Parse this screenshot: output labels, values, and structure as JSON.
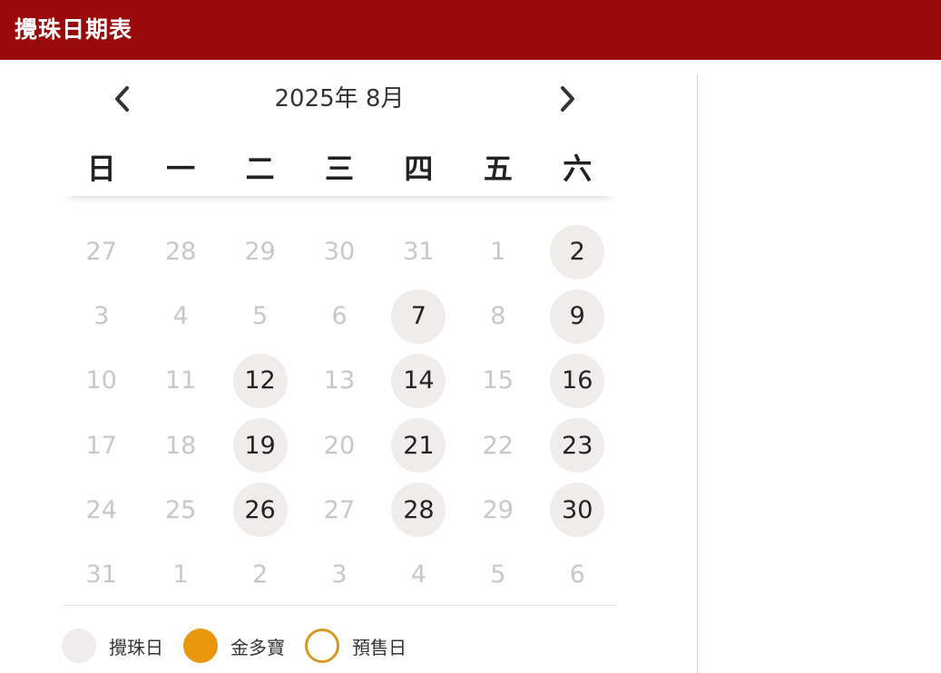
{
  "header": {
    "title": "攪珠日期表"
  },
  "calendar": {
    "month_label": "2025年 8月",
    "prev_icon": "chevron-left-icon",
    "next_icon": "chevron-right-icon",
    "weekdays": [
      "日",
      "一",
      "二",
      "三",
      "四",
      "五",
      "六"
    ],
    "weeks": [
      [
        {
          "d": "27",
          "a": false
        },
        {
          "d": "28",
          "a": false
        },
        {
          "d": "29",
          "a": false
        },
        {
          "d": "30",
          "a": false
        },
        {
          "d": "31",
          "a": false
        },
        {
          "d": "1",
          "a": false
        },
        {
          "d": "2",
          "a": true
        }
      ],
      [
        {
          "d": "3",
          "a": false
        },
        {
          "d": "4",
          "a": false
        },
        {
          "d": "5",
          "a": false
        },
        {
          "d": "6",
          "a": false
        },
        {
          "d": "7",
          "a": true
        },
        {
          "d": "8",
          "a": false
        },
        {
          "d": "9",
          "a": true
        }
      ],
      [
        {
          "d": "10",
          "a": false
        },
        {
          "d": "11",
          "a": false
        },
        {
          "d": "12",
          "a": true
        },
        {
          "d": "13",
          "a": false
        },
        {
          "d": "14",
          "a": true
        },
        {
          "d": "15",
          "a": false
        },
        {
          "d": "16",
          "a": true
        }
      ],
      [
        {
          "d": "17",
          "a": false
        },
        {
          "d": "18",
          "a": false
        },
        {
          "d": "19",
          "a": true
        },
        {
          "d": "20",
          "a": false
        },
        {
          "d": "21",
          "a": true
        },
        {
          "d": "22",
          "a": false
        },
        {
          "d": "23",
          "a": true
        }
      ],
      [
        {
          "d": "24",
          "a": false
        },
        {
          "d": "25",
          "a": false
        },
        {
          "d": "26",
          "a": true
        },
        {
          "d": "27",
          "a": false
        },
        {
          "d": "28",
          "a": true
        },
        {
          "d": "29",
          "a": false
        },
        {
          "d": "30",
          "a": true
        }
      ],
      [
        {
          "d": "31",
          "a": false
        },
        {
          "d": "1",
          "a": false
        },
        {
          "d": "2",
          "a": false
        },
        {
          "d": "3",
          "a": false
        },
        {
          "d": "4",
          "a": false
        },
        {
          "d": "5",
          "a": false
        },
        {
          "d": "6",
          "a": false
        }
      ]
    ]
  },
  "legend": [
    {
      "label": "攪珠日",
      "style": "fill",
      "color": "#f1ecec"
    },
    {
      "label": "金多寶",
      "style": "fill",
      "color": "#e8960c"
    },
    {
      "label": "預售日",
      "style": "ring",
      "color": "#d49a1e"
    }
  ],
  "colors": {
    "header_bg": "#990a0a",
    "draw_day": "#f1ecec",
    "jackpot": "#e8960c",
    "presale": "#d49a1e"
  }
}
